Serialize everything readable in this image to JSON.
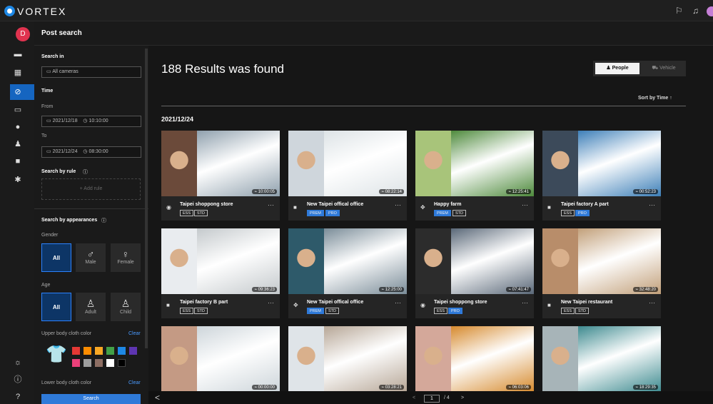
{
  "app": {
    "brand": "VORTEX",
    "avatar_letter": "D"
  },
  "header": {
    "title": "Post search"
  },
  "sidebar": {
    "search_in_label": "Search in",
    "search_in_value": "All cameras",
    "time_label": "Time",
    "from_label": "From",
    "from_date": "2021/12/18",
    "from_time": "10:10:00",
    "to_label": "To",
    "to_date": "2021/12/24",
    "to_time": "08:30:00",
    "rule_label": "Search by rule",
    "add_rule": "+ Add rule",
    "appearance_label": "Search by appearances",
    "gender_label": "Gender",
    "gender_options": [
      "All",
      "Male",
      "Female"
    ],
    "age_label": "Age",
    "age_options": [
      "All",
      "Adult",
      "Child"
    ],
    "upper_label": "Upper body cloth color",
    "upper_clear": "Clear",
    "lower_label": "Lower body cloth color",
    "lower_clear": "Clear",
    "search_button": "Search",
    "colors": [
      "#e53935",
      "#fb8c00",
      "#f9a825",
      "#43a047",
      "#1e88e5",
      "#5e35b1",
      "#ec407a",
      "#9e9e9e",
      "#8d6e63",
      "#ffffff",
      "#000000"
    ]
  },
  "main": {
    "results_text": "188 Results was found",
    "people_label": "People",
    "vehicle_label": "Vehicle",
    "sort_label": "Sort by Time ↑",
    "date_heading": "2021/12/24",
    "pager": {
      "current": "1",
      "total": "/ 4",
      "prev": "<",
      "next": ">"
    }
  },
  "cards": [
    {
      "name": "Taipei shoppong store",
      "time": "10:00:05",
      "tags": [
        "ESS",
        "STD"
      ],
      "icon": "eye-icon"
    },
    {
      "name": "New Taipei offical office",
      "time": "08:22:14",
      "tags": [
        "PREM",
        "PRO"
      ],
      "icon": "camera-icon"
    },
    {
      "name": "Happy farm",
      "time": "12:25:41",
      "tags": [
        "PREM",
        "STD"
      ],
      "icon": "ptz-icon"
    },
    {
      "name": "Taipei factory A part",
      "time": "00:52:23",
      "tags": [
        "ESS",
        "PRO"
      ],
      "icon": "camera-icon"
    },
    {
      "name": "Taipei factory B part",
      "time": "09:36:23",
      "tags": [
        "ESS",
        "STD"
      ],
      "icon": "camera-icon"
    },
    {
      "name": "New Taipei offical office",
      "time": "12:25:00",
      "tags": [
        "PREM",
        "STD"
      ],
      "icon": "ptz-icon"
    },
    {
      "name": "Taipei shoppong store",
      "time": "07:41:47",
      "tags": [
        "ESS",
        "PRO"
      ],
      "icon": "eye-icon"
    },
    {
      "name": "New Taipei restaurant",
      "time": "32:48:20",
      "tags": [
        "ESS",
        "STD"
      ],
      "icon": "camera-icon"
    },
    {
      "name": "",
      "time": "00:00:00",
      "tags": [],
      "icon": ""
    },
    {
      "name": "",
      "time": "03:28:21",
      "tags": [],
      "icon": ""
    },
    {
      "name": "",
      "time": "06:03:06",
      "tags": [],
      "icon": ""
    },
    {
      "name": "",
      "time": "18:29:35",
      "tags": [],
      "icon": ""
    }
  ]
}
